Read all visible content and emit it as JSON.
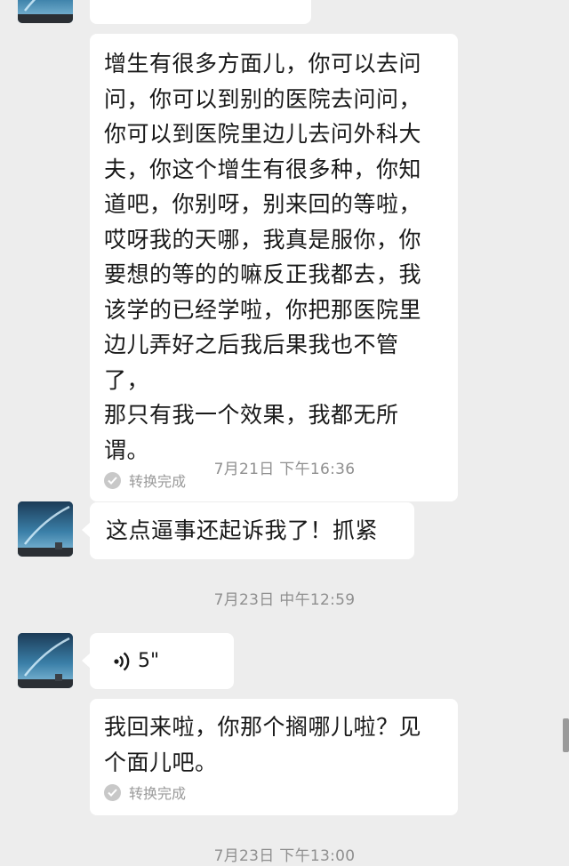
{
  "messages": [
    {
      "text": "增生有很多方面儿，你可以去问\n问，你可以到别的医院去问问，\n你可以到医院里边儿去问外科大\n夫，你这个增生有很多种，你知\n道吧，你别呀，别来回的等啦，\n哎呀我的天哪，我真是服你，你\n要想的等的的嘛反正我都去，我\n该学的已经学啦，你把那医院里\n边儿弄好之后我后果我也不管了，\n那只有我一个效果，我都无所谓。",
      "status": "转换完成"
    },
    {
      "text": "这点逼事还起诉我了！抓紧"
    },
    {
      "voice_duration": "5\""
    },
    {
      "text": "我回来啦，你那个搁哪儿啦？见\n个面儿吧。",
      "status": "转换完成"
    }
  ],
  "timestamps": {
    "t1": "7月21日 下午16:36",
    "t2": "7月23日 中午12:59",
    "t3": "7月23日 下午13:00"
  },
  "icons": {
    "avatar": "sky-avatar-icon",
    "voice": "voice-wave-icon",
    "check": "check-circle-icon"
  },
  "colors": {
    "background": "#ededed",
    "bubble": "#ffffff",
    "text": "#191919",
    "meta": "#8f8f8f"
  }
}
